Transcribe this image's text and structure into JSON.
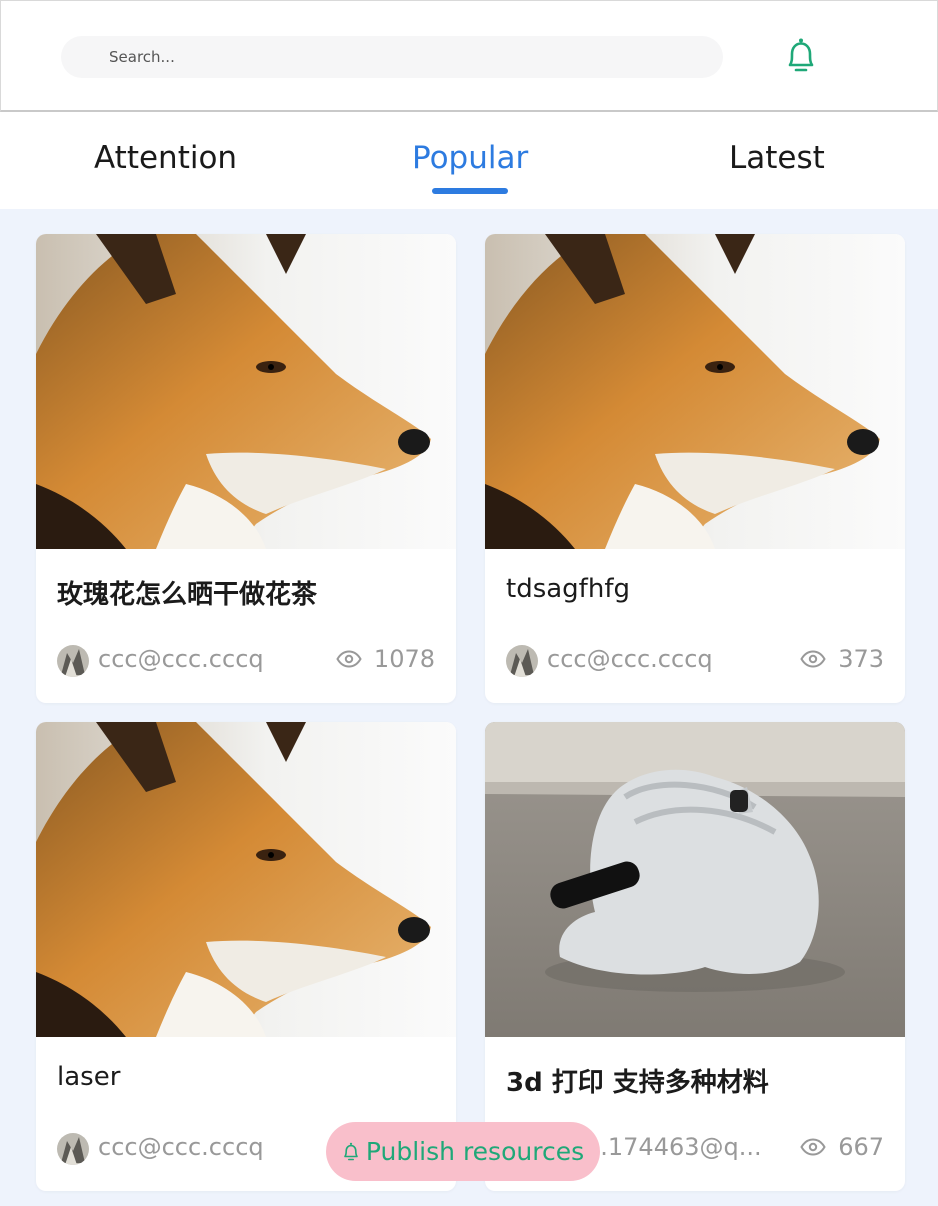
{
  "search": {
    "placeholder": "Search..."
  },
  "header": {
    "notification_icon": "bell-icon"
  },
  "tabs": [
    {
      "label": "Attention",
      "active": false
    },
    {
      "label": "Popular",
      "active": true
    },
    {
      "label": "Latest",
      "active": false
    }
  ],
  "cards": [
    {
      "image": "fox-photo",
      "title": "玫瑰花怎么晒干做花茶",
      "author": "ccc@ccc.cccq",
      "views": "1078"
    },
    {
      "image": "fox-photo",
      "title": "tdsagfhfg",
      "author": "ccc@ccc.cccq",
      "views": "373"
    },
    {
      "image": "fox-photo",
      "title": "laser",
      "author": "ccc@ccc.cccq",
      "views": ""
    },
    {
      "image": "3d-printed-frog-photo",
      "title": "3d 打印 支持多种材料",
      "author": "...174463@q...",
      "views": "667"
    }
  ],
  "publish": {
    "label": "Publish resources",
    "icon": "bell-icon"
  },
  "colors": {
    "accent": "#2d7be0",
    "bell_green": "#1fa878",
    "feed_bg": "#eef3fc",
    "publish_bg": "#f9bfcb"
  }
}
